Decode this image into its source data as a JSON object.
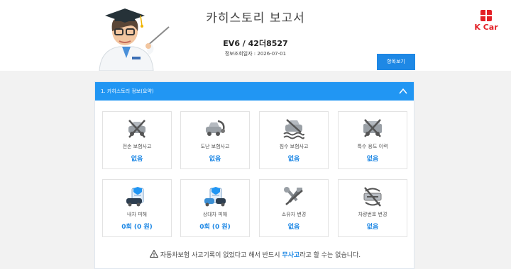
{
  "header": {
    "title": "카히스토리 보고서",
    "car_id": "EV6 / 42더8527",
    "lookup_label": "정보조회일자 : ",
    "lookup_date": "2026-07-01",
    "detail_button": "항목보기"
  },
  "brand": {
    "name": "K Car"
  },
  "panel": {
    "title": "1. 카히스토리 정보(요약)",
    "collapse_icon": "chevron-up-icon",
    "cards": [
      {
        "label": "전손 보험사고",
        "value": "없음",
        "icon": "total-loss-car-icon"
      },
      {
        "label": "도난 보험사고",
        "value": "없음",
        "icon": "theft-car-icon"
      },
      {
        "label": "침수 보험사고",
        "value": "없음",
        "icon": "flood-car-icon"
      },
      {
        "label": "특수 용도 이력",
        "value": "없음",
        "icon": "special-use-car-icon"
      },
      {
        "label": "내차 피해",
        "value": "0회 (0 원)",
        "icon": "my-car-damage-icon"
      },
      {
        "label": "상대차 피해",
        "value": "0회 (0 원)",
        "icon": "other-car-damage-icon"
      },
      {
        "label": "소유자 변경",
        "value": "없음",
        "icon": "owner-change-icon"
      },
      {
        "label": "차량번호 변경",
        "value": "없음",
        "icon": "plate-change-icon"
      }
    ],
    "notice_prefix": "자동차보험 사고기록이 없었다고 해서 반드시 ",
    "notice_highlight": "무사고",
    "notice_suffix": "라고 할 수는 없습니다.",
    "notice_icon": "warning-icon"
  },
  "colors": {
    "accent": "#2196f3",
    "value_blue": "#1e88e5",
    "brand_red": "#e31f26"
  }
}
